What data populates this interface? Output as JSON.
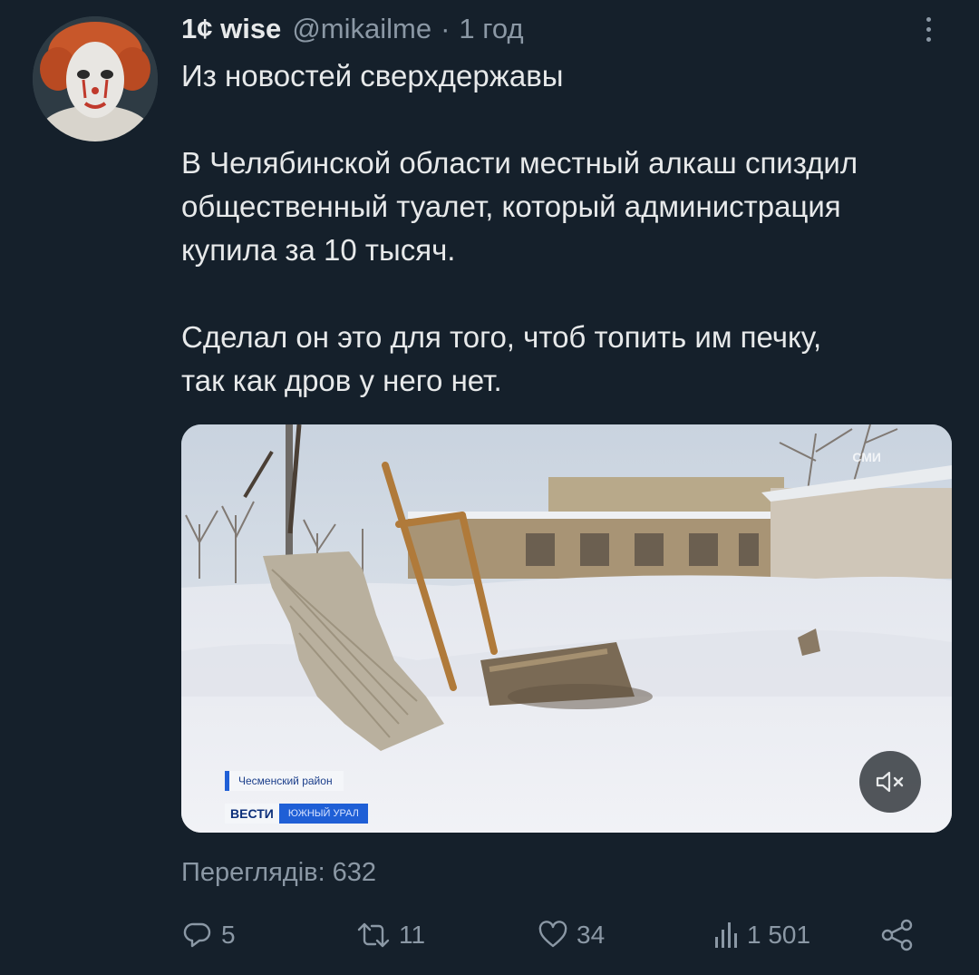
{
  "tweet": {
    "author": {
      "display_name": "1¢ wise",
      "handle": "@mikailme",
      "separator": "·",
      "time": "1 год"
    },
    "text_lines": [
      "Из новостей сверхдержавы",
      "",
      "В Челябинской области местный алкаш спиздил",
      "общественный туалет, который администрация",
      "купила за 10 тысяч.",
      "",
      "Сделал он это для того, чтоб топить им печку,",
      "так как дров у него нет."
    ],
    "video": {
      "caption_region": "Чесменский район",
      "caption_brand": "ВЕСТИ",
      "caption_brand_region": "ЮЖНЫЙ УРАЛ",
      "watermark": "СМИ",
      "mute_icon": "speaker-muted-icon"
    },
    "views_label": "Переглядів: 632",
    "actions": {
      "replies": "5",
      "retweets": "11",
      "likes": "34",
      "views": "1 501"
    }
  },
  "colors": {
    "background": "#15202b",
    "text_primary": "#e7e9ea",
    "text_secondary": "#8b98a5"
  },
  "icons": {
    "reply": "reply-icon",
    "retweet": "retweet-icon",
    "like": "heart-icon",
    "views": "bar-chart-icon",
    "share": "share-icon",
    "more": "more-vertical-icon"
  }
}
